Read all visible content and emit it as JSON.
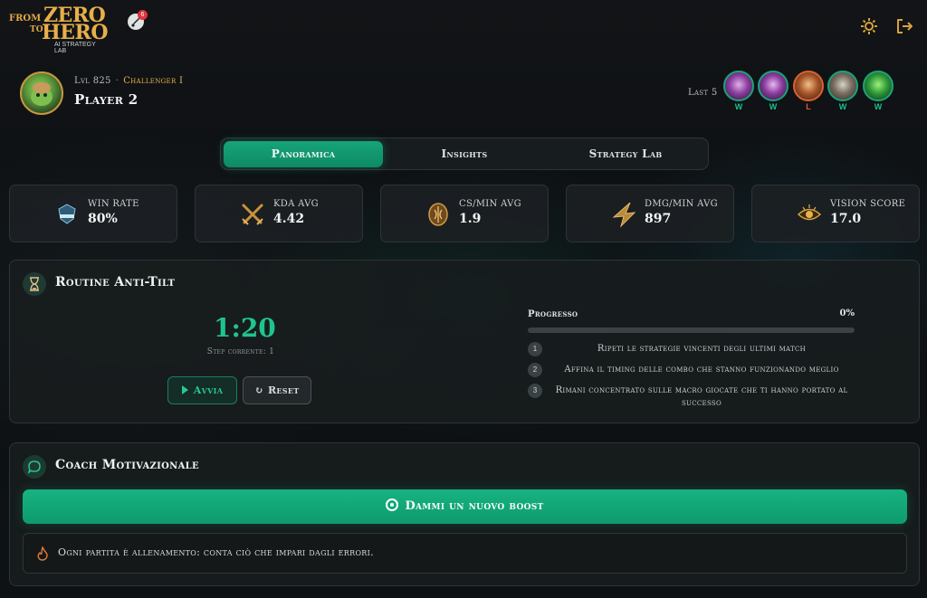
{
  "logo": {
    "from": "FROM",
    "zero": "ZERO",
    "to": "TO",
    "hero": "HERO",
    "subtitle": "AI STRATEGY LAB"
  },
  "notification_count": "6",
  "profile": {
    "level": "Lvl 825",
    "rank": "Challenger I",
    "name": "Player 2"
  },
  "last5": {
    "label": "Last 5",
    "results": [
      "W",
      "W",
      "L",
      "W",
      "W"
    ]
  },
  "tabs": [
    "Panoramica",
    "Insights",
    "Strategy Lab"
  ],
  "active_tab": "Panoramica",
  "stats": [
    {
      "label": "WIN RATE",
      "value": "80%",
      "icon": "victory-badge-icon"
    },
    {
      "label": "KDA AVG",
      "value": "4.42",
      "icon": "crossed-swords-icon"
    },
    {
      "label": "CS/MIN AVG",
      "value": "1.9",
      "icon": "cs-coin-icon"
    },
    {
      "label": "DMG/MIN AVG",
      "value": "897",
      "icon": "damage-star-icon"
    },
    {
      "label": "VISION SCORE",
      "value": "17.0",
      "icon": "eye-icon"
    }
  ],
  "routine": {
    "title": "Routine Anti-Tilt",
    "timer": "1:20",
    "step_label": "Step corrente: 1",
    "start_label": "Avvia",
    "reset_label": "Reset",
    "progress_label": "Progresso",
    "progress_pct": "0%",
    "progress_value": 0,
    "steps": [
      {
        "num": "1",
        "text": "Ripeti le strategie vincenti degli ultimi match"
      },
      {
        "num": "2",
        "text": "Affina il timing delle combo che stanno funzionando meglio"
      },
      {
        "num": "3",
        "text": "Rimani concentrato sulle macro giocate che ti hanno portato al successo"
      }
    ]
  },
  "coach": {
    "title": "Coach Motivazionale",
    "boost_label": "Dammi un nuovo boost",
    "quote": "Ogni partita è allenamento: conta ciò che impari dagli errori."
  },
  "colors": {
    "accent": "#16a47a",
    "gold": "#e8b04a",
    "win": "#19c08c",
    "loss": "#e35a3a"
  }
}
